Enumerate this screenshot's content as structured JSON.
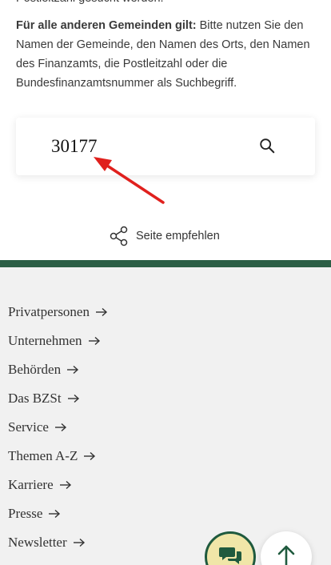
{
  "intro": {
    "truncated_line": "Postleitzahl gesucht werden.",
    "rule_bold": "Für alle anderen Gemeinden gilt:",
    "rule_text": " Bitte nutzen Sie den Namen der Gemeinde, den Namen des Orts, den Namen des Finanzamts, die Postleitzahl oder die Bundesfinanzamtsnummer als Suchbegriff."
  },
  "search": {
    "value": "30177",
    "icon": "search-icon"
  },
  "recommend": {
    "label": "Seite empfehlen",
    "icon": "share-icon"
  },
  "footer": {
    "accent_color": "#2b5e45",
    "nav": [
      {
        "label": "Privatpersonen"
      },
      {
        "label": "Unternehmen"
      },
      {
        "label": "Behörden"
      },
      {
        "label": "Das BZSt"
      },
      {
        "label": "Service"
      },
      {
        "label": "Themen A-Z"
      },
      {
        "label": "Karriere"
      },
      {
        "label": "Presse"
      },
      {
        "label": "Newsletter"
      }
    ]
  },
  "floating": {
    "chat_icon": "chat-bubbles-icon",
    "top_icon": "arrow-up-icon"
  },
  "annotation": {
    "arrow_color": "#e0201d"
  }
}
